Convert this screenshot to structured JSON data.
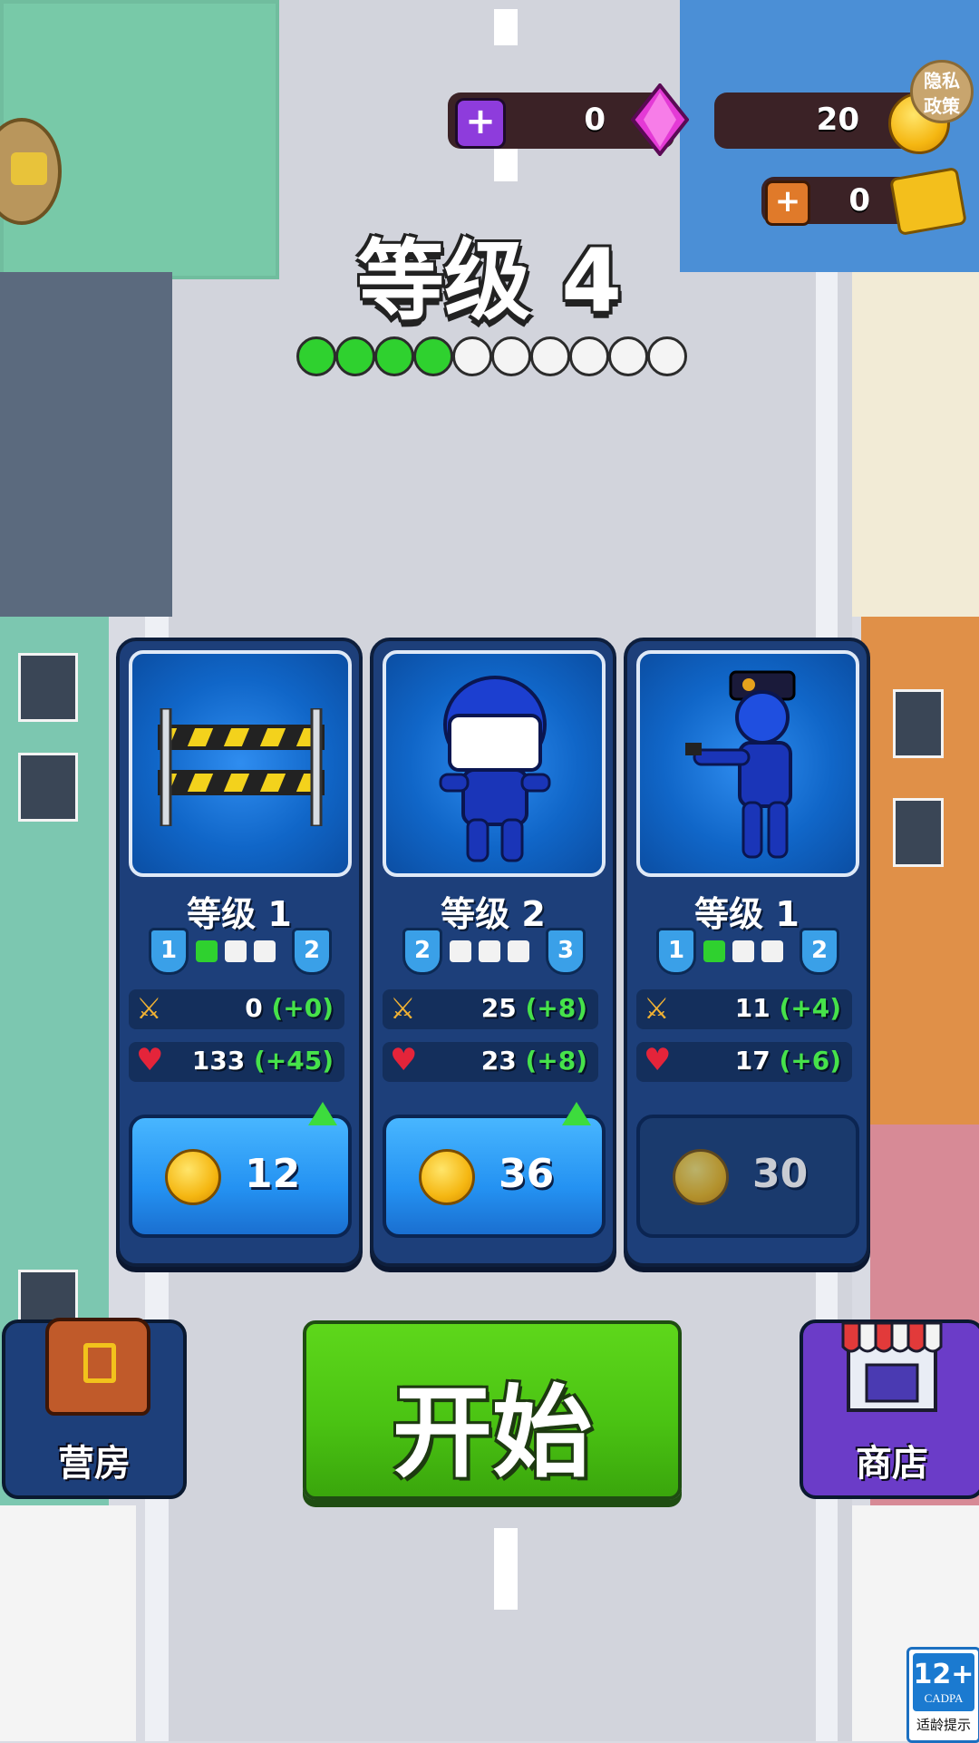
{
  "hud": {
    "gems": "0",
    "coins": "20",
    "tickets": "0",
    "privacy_label": "隐私政策"
  },
  "level": {
    "title": "等级 4",
    "progress": {
      "filled": 4,
      "total": 10
    }
  },
  "cards": [
    {
      "name": "barricade",
      "level_label": "等级 1",
      "level_from": "1",
      "level_to": "2",
      "pips_filled": 1,
      "pips_total": 3,
      "attack": "0",
      "attack_bonus": "(+0)",
      "health": "133",
      "health_bonus": "(+45)",
      "cost": "12",
      "affordable": true
    },
    {
      "name": "riot-police",
      "level_label": "等级 2",
      "level_from": "2",
      "level_to": "3",
      "pips_filled": 0,
      "pips_total": 3,
      "attack": "25",
      "attack_bonus": "(+8)",
      "health": "23",
      "health_bonus": "(+8)",
      "cost": "36",
      "affordable": true
    },
    {
      "name": "police-officer",
      "level_label": "等级 1",
      "level_from": "1",
      "level_to": "2",
      "pips_filled": 1,
      "pips_total": 3,
      "attack": "11",
      "attack_bonus": "(+4)",
      "health": "17",
      "health_bonus": "(+6)",
      "cost": "30",
      "affordable": false
    }
  ],
  "buttons": {
    "barracks": "营房",
    "start": "开始",
    "shop": "商店"
  },
  "age_rating": {
    "number": "12+",
    "org": "CADPA",
    "caption": "适龄提示"
  },
  "colors": {
    "accent_green": "#4bc413",
    "card_blue": "#1d3f7a",
    "shop_purple": "#6b3cc8",
    "gem_pink": "#e43ad6",
    "coin_gold": "#f5b712"
  }
}
